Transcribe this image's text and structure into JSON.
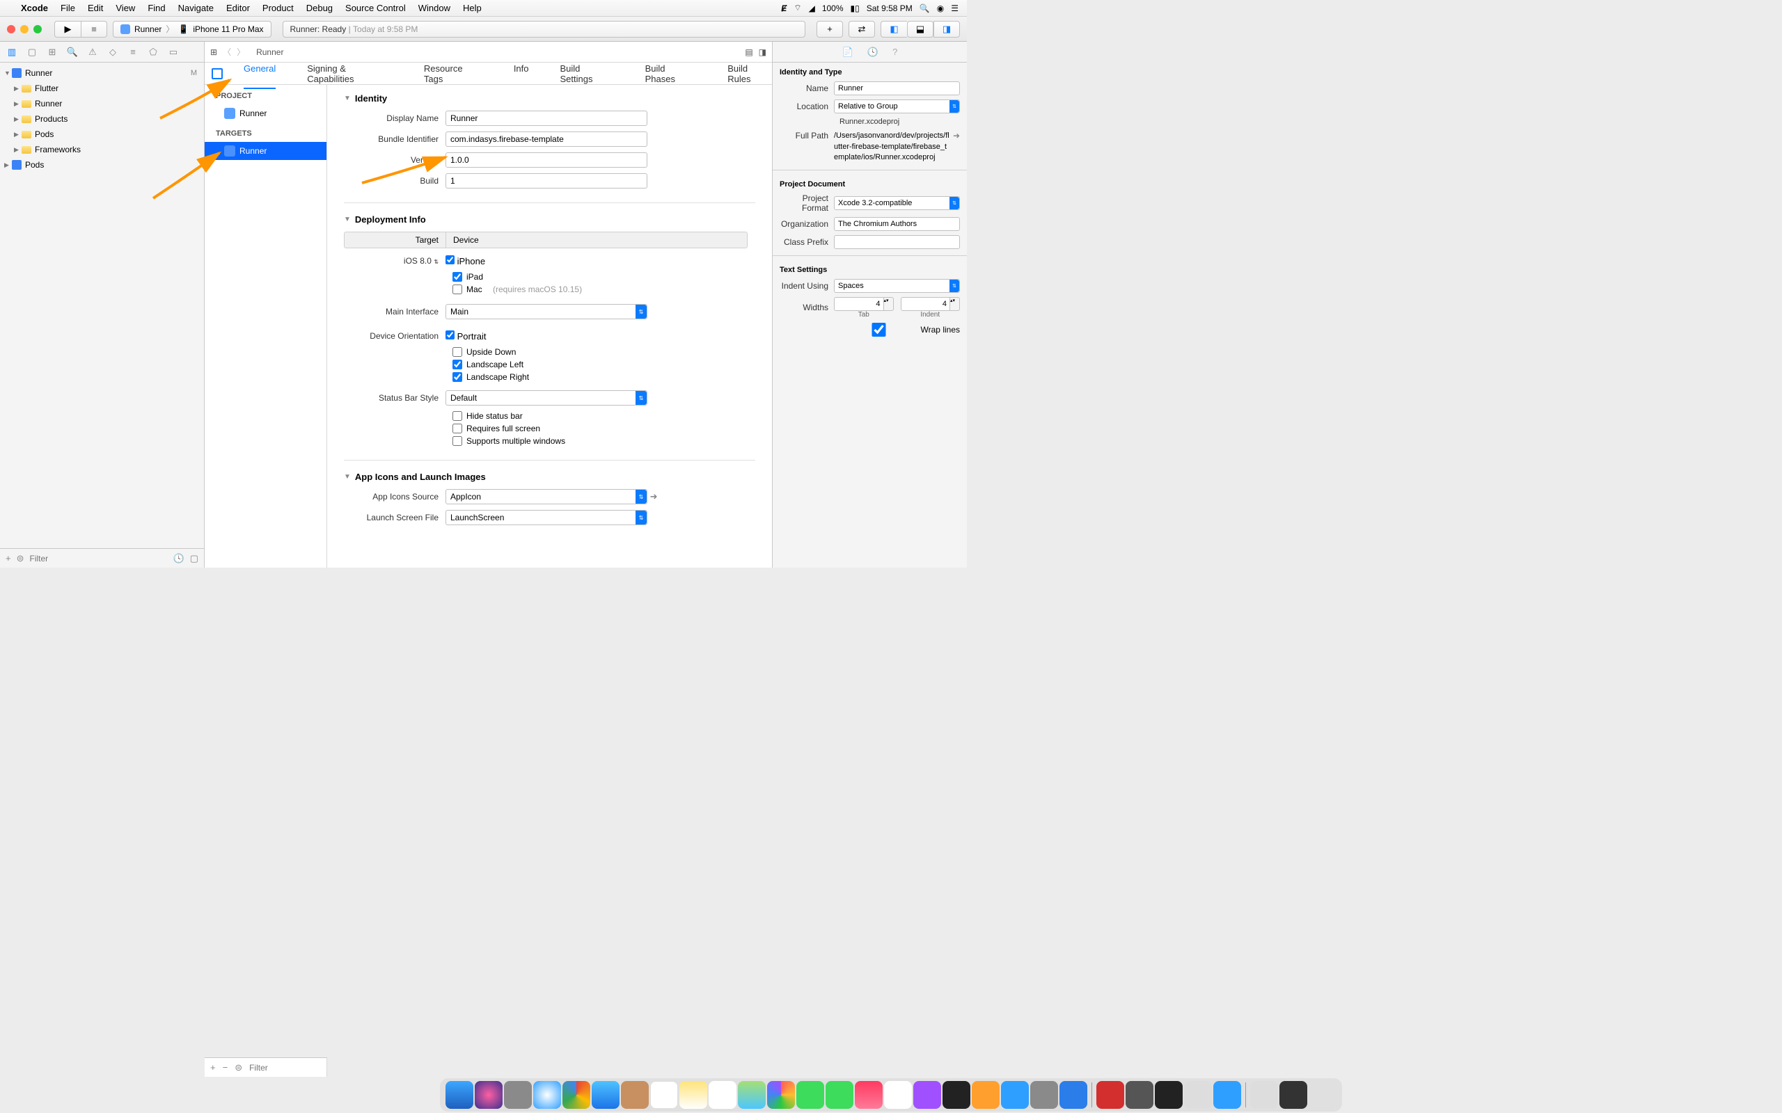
{
  "menubar": {
    "app": "Xcode",
    "items": [
      "File",
      "Edit",
      "View",
      "Find",
      "Navigate",
      "Editor",
      "Product",
      "Debug",
      "Source Control",
      "Window",
      "Help"
    ],
    "battery": "100%",
    "time": "Sat 9:58 PM"
  },
  "toolbar": {
    "scheme_app": "Runner",
    "scheme_device": "iPhone 11 Pro Max",
    "status_app": "Runner:",
    "status_state": "Ready",
    "status_time": "Today at 9:58 PM"
  },
  "navigator": {
    "project": "Runner",
    "badge": "M",
    "items": [
      "Flutter",
      "Runner",
      "Products",
      "Pods",
      "Frameworks"
    ],
    "root2": "Pods",
    "filter_placeholder": "Filter"
  },
  "jumpbar": {
    "path": "Runner"
  },
  "tabs": [
    "General",
    "Signing & Capabilities",
    "Resource Tags",
    "Info",
    "Build Settings",
    "Build Phases",
    "Build Rules"
  ],
  "targets_panel": {
    "project_label": "PROJECT",
    "project_item": "Runner",
    "targets_label": "TARGETS",
    "target_item": "Runner",
    "filter_placeholder": "Filter"
  },
  "identity": {
    "header": "Identity",
    "display_name_label": "Display Name",
    "display_name": "Runner",
    "bundle_id_label": "Bundle Identifier",
    "bundle_id": "com.indasys.firebase-template",
    "version_label": "Version",
    "version": "1.0.0",
    "build_label": "Build",
    "build": "1"
  },
  "deployment": {
    "header": "Deployment Info",
    "target_label": "Target",
    "device_label": "Device",
    "ios_version": "iOS 8.0",
    "iphone": "iPhone",
    "ipad": "iPad",
    "mac": "Mac",
    "mac_req": "(requires macOS 10.15)",
    "main_interface_label": "Main Interface",
    "main_interface": "Main",
    "orientation_label": "Device Orientation",
    "orient_portrait": "Portrait",
    "orient_upside": "Upside Down",
    "orient_left": "Landscape Left",
    "orient_right": "Landscape Right",
    "status_bar_label": "Status Bar Style",
    "status_bar_style": "Default",
    "hide_status": "Hide status bar",
    "req_fullscreen": "Requires full screen",
    "multi_windows": "Supports multiple windows"
  },
  "appicons": {
    "header": "App Icons and Launch Images",
    "source_label": "App Icons Source",
    "source": "AppIcon",
    "launch_label": "Launch Screen File",
    "launch": "LaunchScreen"
  },
  "inspector": {
    "h1": "Identity and Type",
    "name_label": "Name",
    "name": "Runner",
    "location_label": "Location",
    "location": "Relative to Group",
    "location_file": "Runner.xcodeproj",
    "fullpath_label": "Full Path",
    "fullpath": "/Users/jasonvanord/dev/projects/flutter-firebase-template/firebase_template/ios/Runner.xcodeproj",
    "h2": "Project Document",
    "format_label": "Project Format",
    "format": "Xcode 3.2-compatible",
    "org_label": "Organization",
    "org": "The Chromium Authors",
    "prefix_label": "Class Prefix",
    "prefix": "",
    "h3": "Text Settings",
    "indent_label": "Indent Using",
    "indent": "Spaces",
    "widths_label": "Widths",
    "tab_width": "4",
    "indent_width": "4",
    "tab_sublabel": "Tab",
    "indent_sublabel": "Indent",
    "wrap": "Wrap lines"
  }
}
